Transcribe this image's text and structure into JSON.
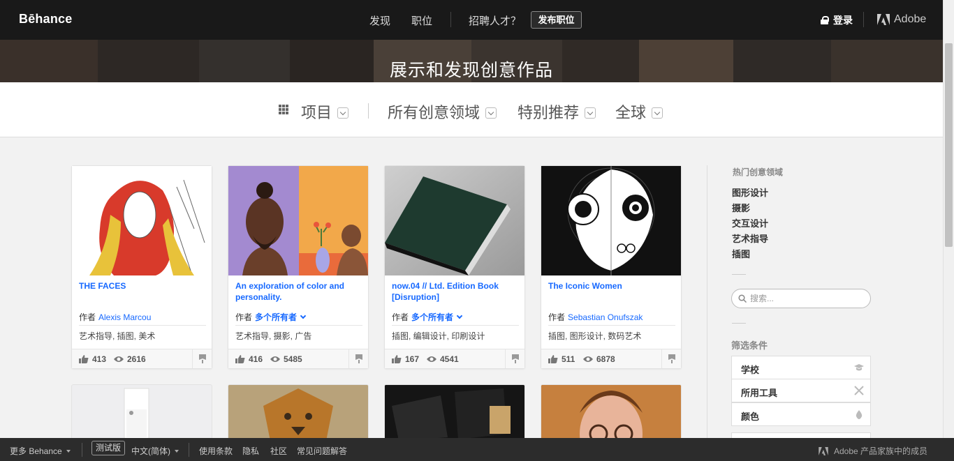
{
  "topnav": {
    "logo": "Bēhance",
    "discover": "发现",
    "jobs": "职位",
    "hire": "招聘人才？",
    "post_job": "发布职位",
    "login": "登录",
    "adobe": "Adobe"
  },
  "hero": {
    "title": "展示和发现创意作品"
  },
  "filters": {
    "projects": "项目",
    "fields": "所有创意领域",
    "featured": "特别推荐",
    "location": "全球"
  },
  "cards": [
    {
      "title": "THE FACES",
      "by": "作者",
      "owner": "Alexis Marcou",
      "multi": false,
      "fields": "艺术指导, 插图, 美术",
      "likes": "413",
      "views": "2616"
    },
    {
      "title": "An exploration of color and personality.",
      "by": "作者",
      "owner": "多个所有者",
      "multi": true,
      "fields": "艺术指导, 摄影, 广告",
      "likes": "416",
      "views": "5485"
    },
    {
      "title": "now.04 // Ltd. Edition Book [Disruption]",
      "by": "作者",
      "owner": "多个所有者",
      "multi": true,
      "fields": "插图, 编辑设计, 印刷设计",
      "likes": "167",
      "views": "4541"
    },
    {
      "title": "The Iconic Women",
      "by": "作者",
      "owner": "Sebastian Onufszak",
      "multi": false,
      "fields": "插图, 图形设计, 数码艺术",
      "likes": "511",
      "views": "6878"
    }
  ],
  "sidebar": {
    "popular_title": "热门创意领域",
    "popular": [
      "图形设计",
      "摄影",
      "交互设计",
      "艺术指导",
      "插图"
    ],
    "search_placeholder": "搜索...",
    "filter_title": "筛选条件",
    "filters": [
      "学校",
      "所用工具",
      "颜色"
    ]
  },
  "footer": {
    "more": "更多 Behance",
    "beta": "测试版",
    "language": "中文(简体)",
    "terms": "使用条款",
    "privacy": "隐私",
    "community": "社区",
    "faq": "常见问题解答",
    "adobe_member": "Adobe 产品家族中的成员"
  },
  "colors": {
    "link": "#1769ff",
    "nav_bg": "#191919",
    "footer_bg": "#2c2c2c"
  },
  "icons": [
    "lock-icon",
    "adobe-icon",
    "grid-icon",
    "chevron-down-icon",
    "like-icon",
    "eye-icon",
    "save-icon",
    "search-icon",
    "school-icon",
    "tools-icon",
    "color-drop-icon"
  ]
}
